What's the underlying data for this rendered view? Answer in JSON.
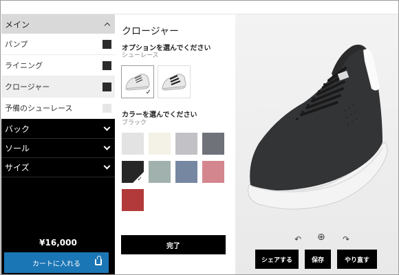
{
  "sidebar": {
    "main_label": "メイン",
    "main_items": [
      {
        "label": "パンプ"
      },
      {
        "label": "ライニング"
      },
      {
        "label": "クロージャー"
      },
      {
        "label": "予備のシューレース"
      }
    ],
    "categories": [
      {
        "label": "バック"
      },
      {
        "label": "ソール"
      },
      {
        "label": "サイズ"
      }
    ],
    "price": "¥16,000",
    "cart_label": "カートに入れる"
  },
  "panel": {
    "title": "クロージャー",
    "option_heading": "オプションを選んでください",
    "option_value": "シューレース",
    "color_heading": "カラーを選んでください",
    "color_value": "ブラック",
    "colors": [
      "#e3e3e3",
      "#f4f1e6",
      "#c2c2c6",
      "#6f7279",
      "#262626",
      "#a1b2ae",
      "#7687a2",
      "#d4868e",
      "#b23a3a"
    ],
    "selected_color_index": 4,
    "done_label": "完了"
  },
  "preview": {
    "share_label": "シェアする",
    "save_label": "保存",
    "redo_label": "やり直す"
  },
  "colors": {
    "accent_blue": "#1b76b5",
    "sidebar_bg": "#000000"
  }
}
